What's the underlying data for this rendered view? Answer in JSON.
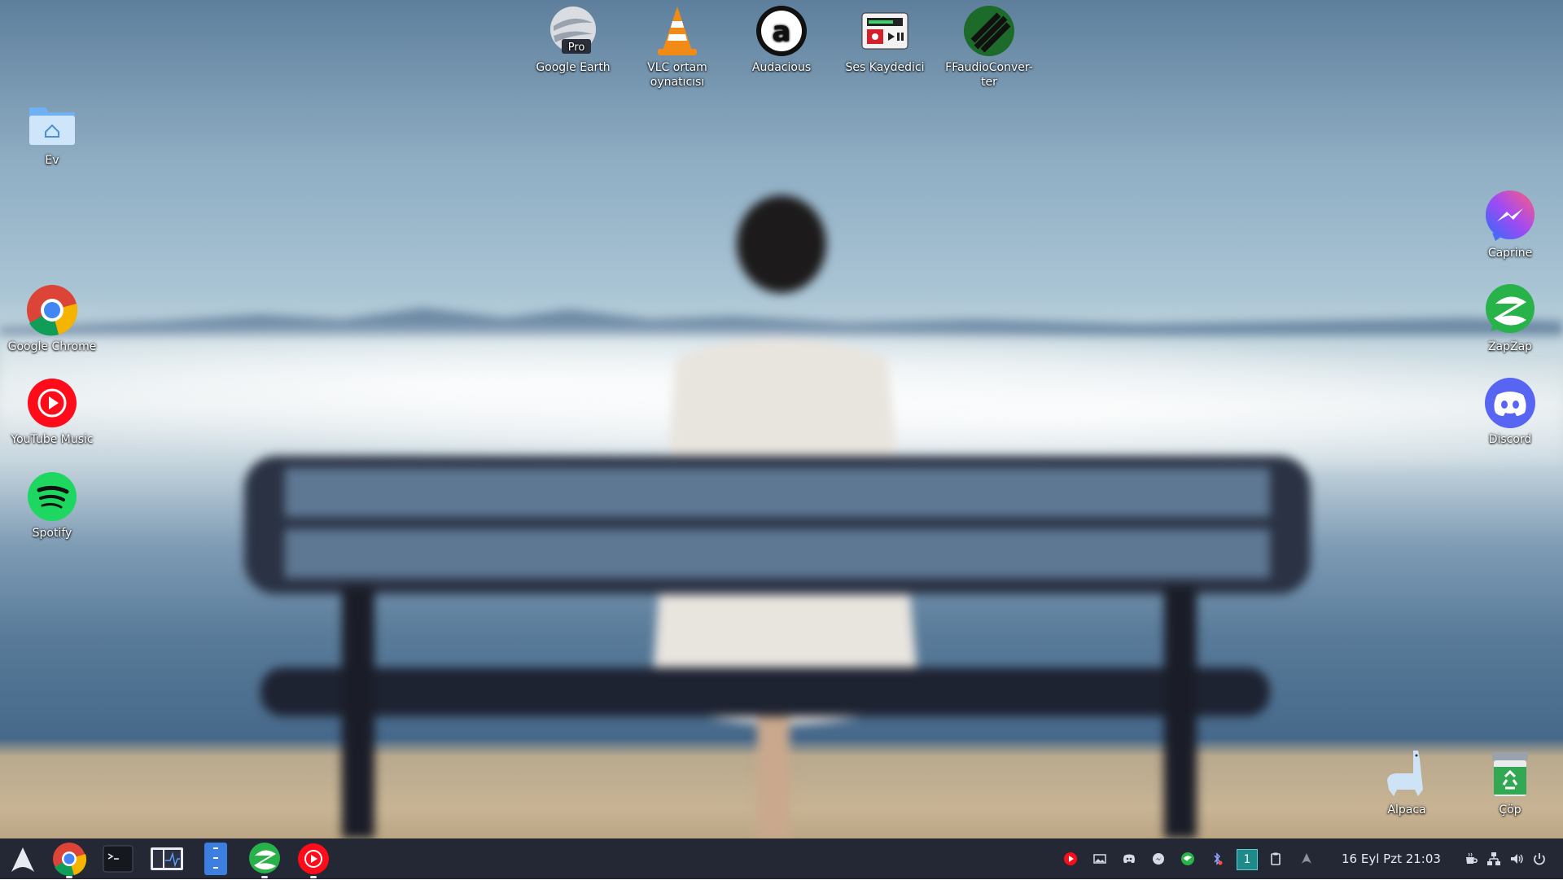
{
  "desktop": {
    "top_icons": [
      {
        "label": "Google Earth",
        "icon": "google-earth-pro-icon",
        "badge": "Pro"
      },
      {
        "label": "VLC ortam oynatıcısı",
        "icon": "vlc-cone-icon"
      },
      {
        "label": "Audacious",
        "icon": "audacious-icon",
        "letter": "a"
      },
      {
        "label": "Ses Kaydedici",
        "icon": "sound-recorder-icon"
      },
      {
        "label": "FFaudioConver-ter",
        "icon": "ffaudioconverter-icon"
      }
    ],
    "left_icons": [
      {
        "label": "Ev",
        "icon": "home-folder-icon"
      },
      {
        "label": "Google Chrome",
        "icon": "chrome-icon"
      },
      {
        "label": "YouTube Music",
        "icon": "youtube-music-icon"
      },
      {
        "label": "Spotify",
        "icon": "spotify-icon"
      }
    ],
    "right_icons": [
      {
        "label": "Caprine",
        "icon": "caprine-messenger-icon"
      },
      {
        "label": "ZapZap",
        "icon": "zapzap-icon"
      },
      {
        "label": "Discord",
        "icon": "discord-icon"
      }
    ],
    "bottom_right_icons": [
      {
        "label": "Alpaca",
        "icon": "alpaca-icon"
      },
      {
        "label": "Çöp",
        "icon": "trash-icon"
      }
    ]
  },
  "taskbar": {
    "launcher_icon": "arch-launcher-icon",
    "apps": [
      "chrome-icon",
      "terminal-icon",
      "system-monitor-icon",
      "file-manager-icon",
      "zapzap-icon",
      "youtube-music-icon"
    ],
    "tray": [
      "youtube-music-tray-icon",
      "image-tray-icon",
      "discord-tray-icon",
      "messenger-tray-icon",
      "zapzap-tray-icon",
      "bluetooth-tray-icon",
      "clipboard-tray-icon",
      "arch-update-tray-icon"
    ],
    "workspace": "1",
    "clock": "16 Eyl Pzt  21:03",
    "right_tray": [
      "caffeine-icon",
      "network-icon",
      "volume-icon",
      "power-icon"
    ]
  },
  "colors": {
    "taskbar_bg": "#232834",
    "chrome_red": "#db4437",
    "spotify_green": "#1ed760",
    "discord_blurple": "#5865f2"
  }
}
